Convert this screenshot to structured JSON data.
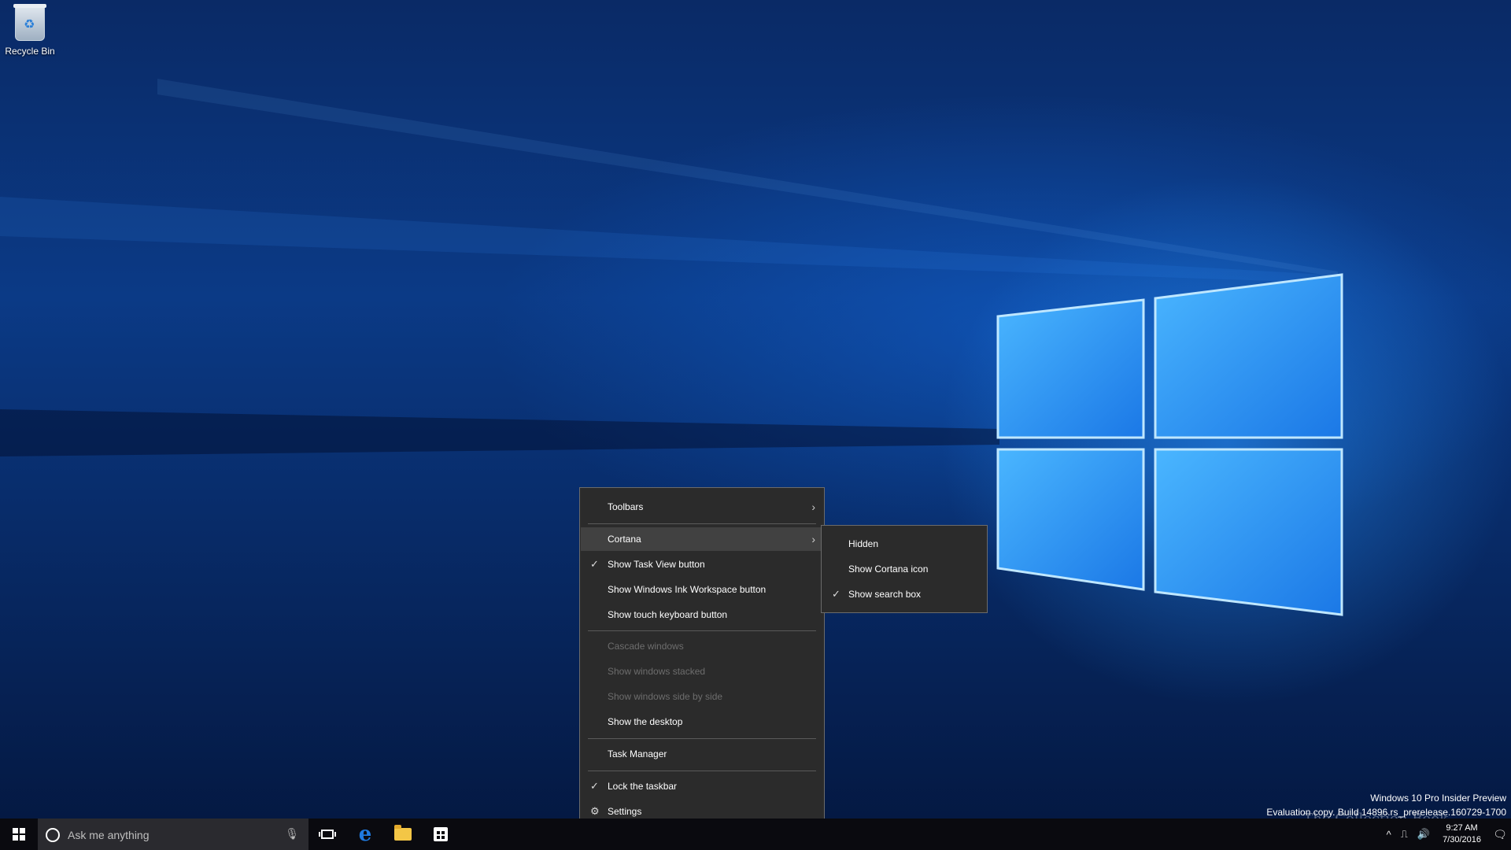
{
  "desktop": {
    "recycle_bin_label": "Recycle Bin"
  },
  "context_menu": {
    "items": [
      {
        "label": "Toolbars"
      },
      {
        "label": "Cortana"
      },
      {
        "label": "Show Task View button",
        "checked": true
      },
      {
        "label": "Show Windows Ink Workspace button"
      },
      {
        "label": "Show touch keyboard button"
      },
      {
        "label": "Cascade windows",
        "disabled": true
      },
      {
        "label": "Show windows stacked",
        "disabled": true
      },
      {
        "label": "Show windows side by side",
        "disabled": true
      },
      {
        "label": "Show the desktop"
      },
      {
        "label": "Task Manager"
      },
      {
        "label": "Lock the taskbar",
        "checked": true
      },
      {
        "label": "Settings"
      }
    ]
  },
  "cortana_submenu": {
    "items": [
      {
        "label": "Hidden"
      },
      {
        "label": "Show Cortana icon"
      },
      {
        "label": "Show search box",
        "checked": true
      }
    ]
  },
  "watermark": {
    "line1": "Windows 10 Pro Insider Preview",
    "line2": "Evaluation copy. Build 14896.rs_prerelease.160729-1700"
  },
  "taskbar": {
    "search_placeholder": "Ask me anything",
    "clock_time": "9:27 AM",
    "clock_date": "7/30/2016"
  },
  "overlay_logo": "The Collection Book",
  "colors": {
    "menu_bg": "#2b2b2b",
    "menu_highlight": "#414141",
    "taskbar_bg": "#0a0a0f",
    "accent_blue": "#1f7ae0"
  }
}
